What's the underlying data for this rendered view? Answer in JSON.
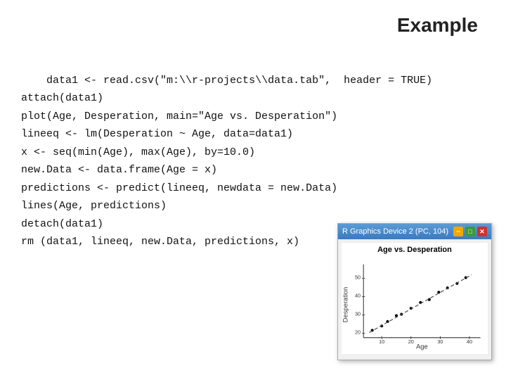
{
  "title": "Example",
  "code": {
    "lines": [
      "data1 <- read.csv(\"m:\\\\r-projects\\\\data.tab\",  header = TRUE)",
      "attach(data1)",
      "plot(Age, Desperation, main=\"Age vs. Desperation\")",
      "lineeq <- lm(Desperation ~ Age, data=data1)",
      "x <- seq(min(Age), max(Age), by=10.0)",
      "new.Data <- data.frame(Age = x)",
      "predictions <- predict(lineeq, newdata = new.Data)",
      "lines(Age, predictions)",
      "detach(data1)",
      "rm (data1, lineeq, new.Data, predictions, x)"
    ]
  },
  "chart": {
    "titlebar_text": "R Graphics Device 2 (PC, 104)",
    "plot_title": "Age vs. Desperation",
    "x_label": "Age",
    "y_label": "Desperation",
    "x_ticks": [
      "10",
      "20",
      "30",
      "40"
    ],
    "y_ticks": [
      "20",
      "30",
      "40",
      "50"
    ]
  },
  "icons": {
    "minimize": "−",
    "maximize": "□",
    "close": "✕"
  }
}
